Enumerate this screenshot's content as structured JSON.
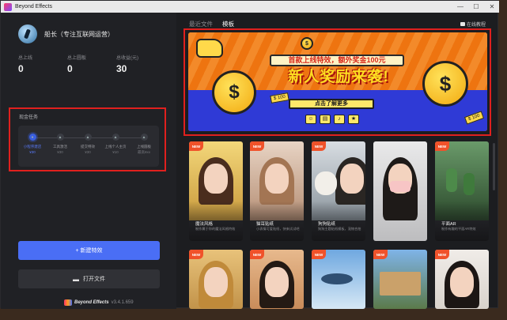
{
  "window": {
    "title": "Beyond Effects"
  },
  "profile": {
    "name": "船长（专注互联网运营）"
  },
  "stats": [
    {
      "label": "总上线",
      "value": "0"
    },
    {
      "label": "总上圆板",
      "value": "0"
    },
    {
      "label": "总收益(元)",
      "value": "30"
    }
  ],
  "tasks": {
    "title": "现金任务",
    "steps": [
      {
        "name": "小程序建店",
        "reward": "¥30",
        "active": true
      },
      {
        "name": "工具激活",
        "reward": "¥30",
        "active": false
      },
      {
        "name": "提交特效",
        "reward": "¥30",
        "active": false
      },
      {
        "name": "上线个人主页",
        "reward": "¥10",
        "active": false
      },
      {
        "name": "上线圆板",
        "reward": "最高¥xx",
        "active": false
      }
    ]
  },
  "buttons": {
    "new_effect": "+ 新建特效",
    "open_file": "打开文件"
  },
  "footer": {
    "brand": "Beyond Effects",
    "version": "v3.4.1.659"
  },
  "tabs": [
    {
      "label": "最近文件",
      "active": false
    },
    {
      "label": "模板",
      "active": true
    }
  ],
  "tutorial": "在线教程",
  "banner": {
    "top_text": "首款上线特效，额外奖金100元",
    "headline": "新人奖励来袭!",
    "cta": "点击了解更多",
    "coin_symbol": "$",
    "tag": "$ 100"
  },
  "cards_row1": [
    {
      "new": "NEW",
      "title": "魔法风格",
      "desc": "制作属于你的魔法风格特效"
    },
    {
      "new": "NEW",
      "title": "猫耳贴纸",
      "desc": "小表情可爱贴纸，快来试试吧"
    },
    {
      "new": "NEW",
      "title": "狗狗贴纸",
      "desc": "狗狗主题贴纸模板，宠物合拍"
    },
    {
      "new": "",
      "title": "",
      "desc": ""
    },
    {
      "new": "NEW",
      "title": "平面AR",
      "desc": "制作有趣的平面AR特效"
    }
  ],
  "cards_row2": [
    {
      "new": "NEW"
    },
    {
      "new": "NEW"
    },
    {
      "new": "NEW"
    },
    {
      "new": "NEW"
    },
    {
      "new": "NEW"
    }
  ],
  "colors": {
    "accent": "#4a6ef5",
    "highlight_box": "#e0201e"
  }
}
